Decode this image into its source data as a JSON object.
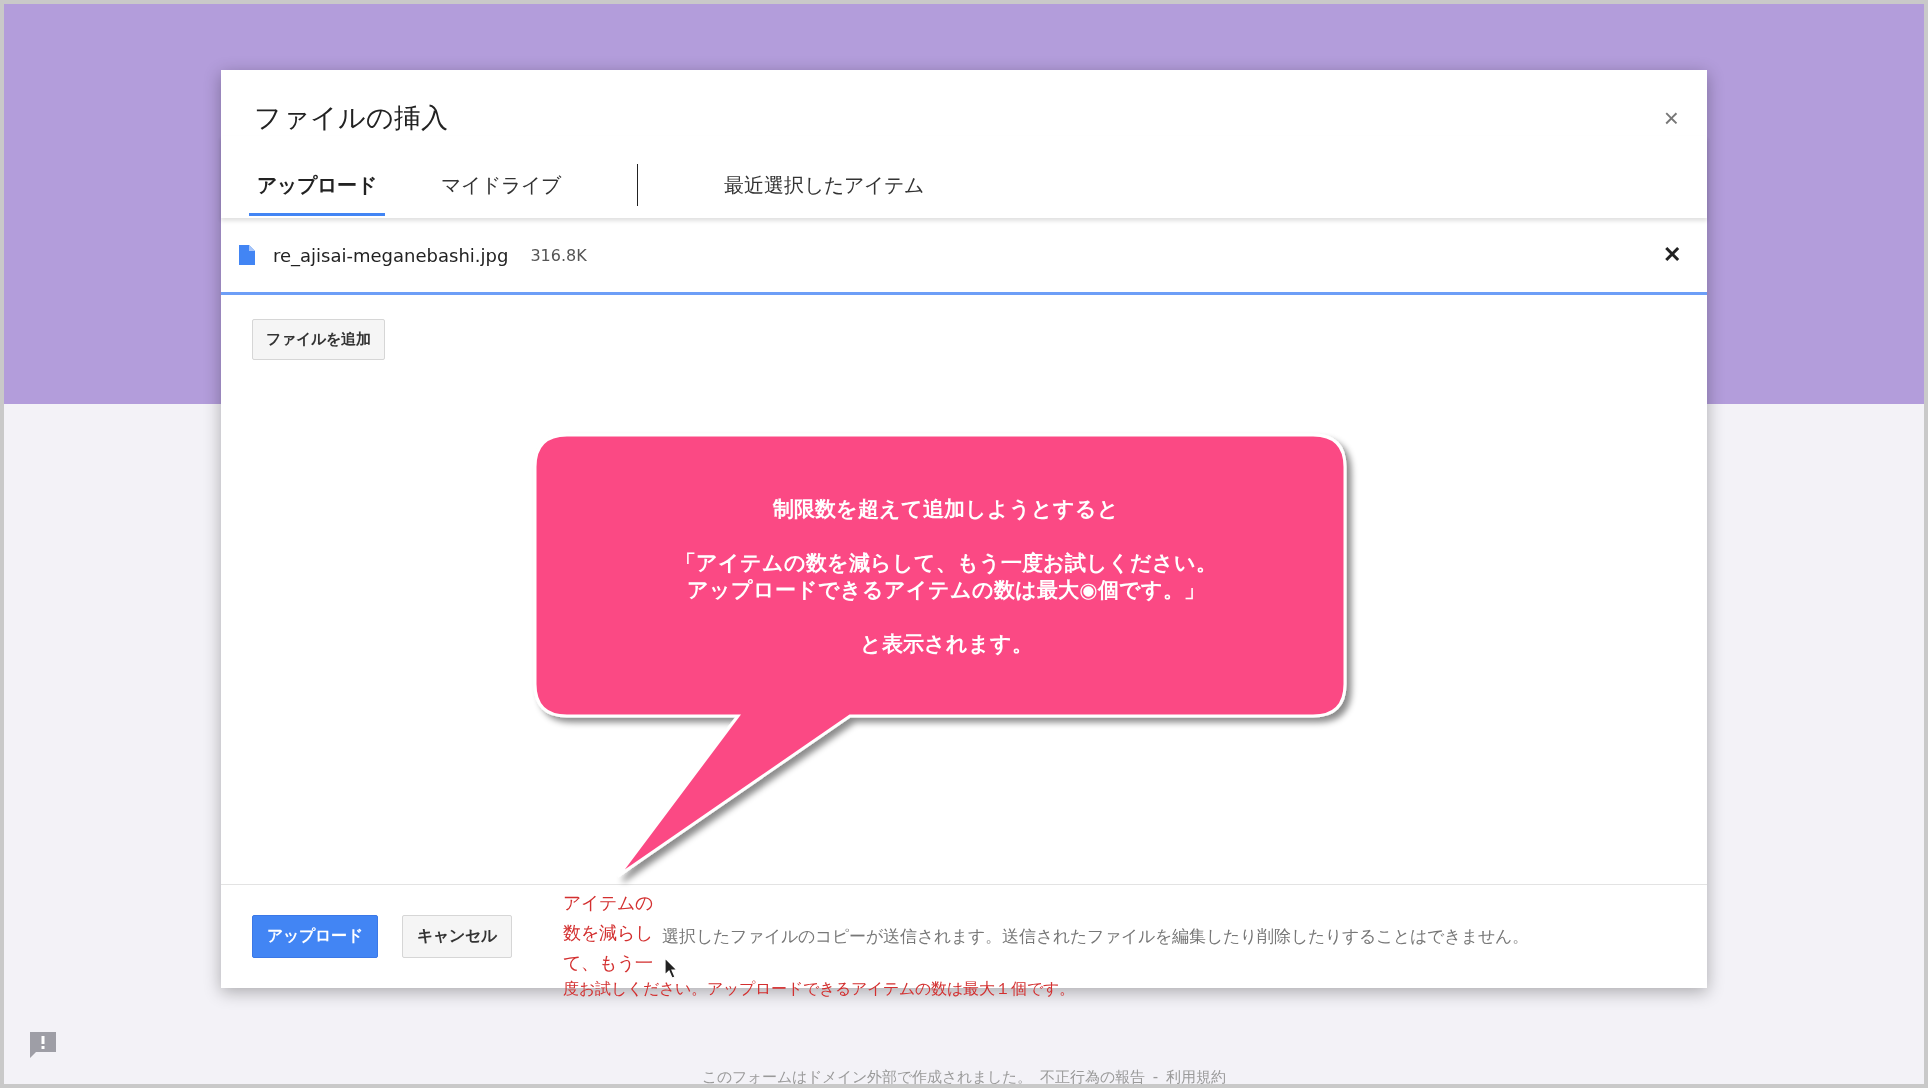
{
  "dialog": {
    "title": "ファイルの挿入",
    "close": "×",
    "tabs": [
      {
        "label": "アップロード",
        "selected": true
      },
      {
        "label": "マイドライブ",
        "selected": false
      },
      {
        "label": "最近選択したアイテム",
        "selected": false
      }
    ],
    "file": {
      "name": "re_ajisai-meganebashi.jpg",
      "size": "316.8K",
      "remove": "✕",
      "level": 1
    },
    "add_button": "ファイルを追加",
    "callout": {
      "paragraphs": [
        "制限数を超えて追加しようとすると",
        "「アイテムの数を減らして、もう一度お試しください。",
        "アップロードできるアイテムの数は最大◉個です。」",
        "と表示されます。"
      ]
    },
    "buttons": [
      {
        "label": "アップロード",
        "kind": "primary"
      },
      {
        "label": "キャンセル",
        "kind": "secondary"
      }
    ],
    "error_lines": [
      "アイテムの",
      "数を減らし",
      "て、もう一",
      "度お試しください。アップロードできるアイテムの数は最大１個です。"
    ],
    "notice": "選択したファイルのコピーが送信されます。送信されたファイルを編集したり削除したりすることはできません。"
  },
  "page_footer": {
    "text": "このフォームはドメイン外部で作成されました。",
    "links": [
      "不正行為の報告",
      "利用規約"
    ],
    "separator": "-"
  }
}
